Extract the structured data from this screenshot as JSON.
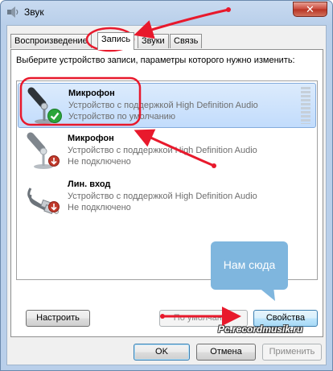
{
  "window": {
    "title": "Звук",
    "close_label": "✕"
  },
  "tabs": [
    {
      "label": "Воспроизведение"
    },
    {
      "label": "Запись"
    },
    {
      "label": "Звуки"
    },
    {
      "label": "Связь"
    }
  ],
  "instruction": "Выберите устройство записи, параметры которого нужно изменить:",
  "devices": [
    {
      "name": "Микрофон",
      "description": "Устройство с поддержкой High Definition Audio",
      "status": "Устройство по умолчанию",
      "icon": "microphone-icon",
      "badge": "check-icon"
    },
    {
      "name": "Микрофон",
      "description": "Устройство с поддержкой High Definition Audio",
      "status": "Не подключено",
      "icon": "microphone-icon",
      "badge": "down-arrow-icon"
    },
    {
      "name": "Лин. вход",
      "description": "Устройство с поддержкой High Definition Audio",
      "status": "Не подключено",
      "icon": "line-in-icon",
      "badge": "down-arrow-icon"
    }
  ],
  "panel_buttons": {
    "configure": "Настроить",
    "set_default": "По умолчанию",
    "properties": "Свойства"
  },
  "dialog_buttons": {
    "ok": "OK",
    "cancel": "Отмена",
    "apply": "Применить"
  },
  "annotation": {
    "callout": "Нам сюда",
    "watermark": "Pc.recordmusik.ru"
  },
  "colors": {
    "annotation_red": "#e8192c",
    "callout_blue": "#7fb6de",
    "check_green": "#2aa53a"
  }
}
